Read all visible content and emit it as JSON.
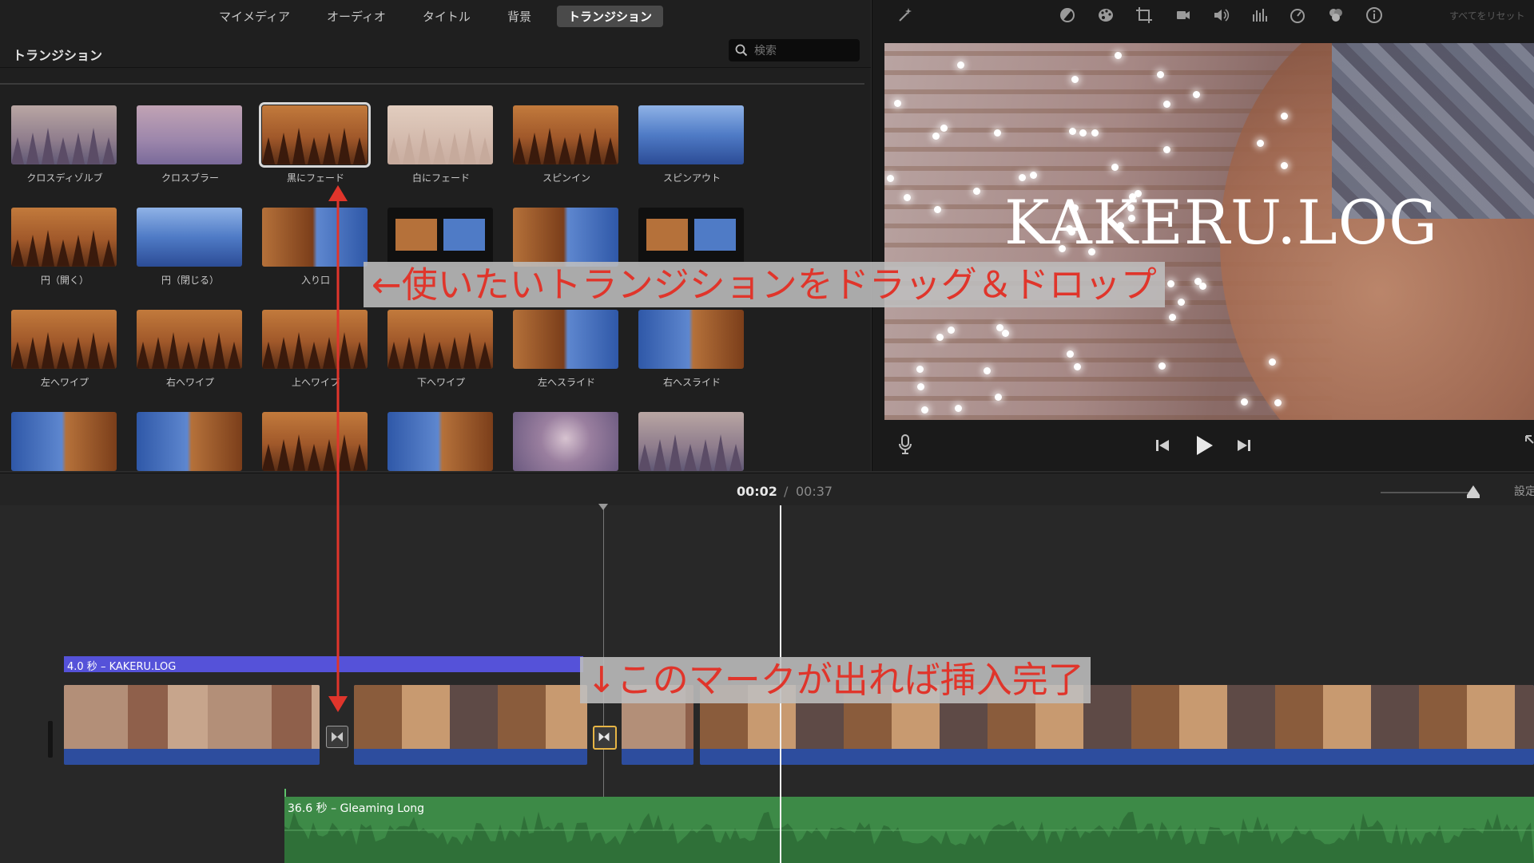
{
  "media_tabs": [
    {
      "label": "マイメディア",
      "active": false
    },
    {
      "label": "オーディオ",
      "active": false
    },
    {
      "label": "タイトル",
      "active": false
    },
    {
      "label": "背景",
      "active": false
    },
    {
      "label": "トランジション",
      "active": true
    }
  ],
  "browser": {
    "title": "トランジション",
    "search_placeholder": "検索"
  },
  "transitions": [
    {
      "label": "クロスディゾルブ",
      "style": "mist",
      "selected": false
    },
    {
      "label": "クロスブラー",
      "style": "blur",
      "selected": false
    },
    {
      "label": "黒にフェード",
      "style": "forest",
      "selected": true
    },
    {
      "label": "白にフェード",
      "style": "pale",
      "selected": false
    },
    {
      "label": "スピンイン",
      "style": "forest",
      "selected": false
    },
    {
      "label": "スピンアウト",
      "style": "blue",
      "selected": false
    },
    {
      "label": "円（開く）",
      "style": "forest",
      "selected": false
    },
    {
      "label": "円（閉じる）",
      "style": "blue",
      "selected": false
    },
    {
      "label": "入り口",
      "style": "half-r",
      "selected": false
    },
    {
      "label": "",
      "style": "black",
      "selected": false
    },
    {
      "label": "",
      "style": "half-r",
      "selected": false
    },
    {
      "label": "",
      "style": "black",
      "selected": false
    },
    {
      "label": "左へワイプ",
      "style": "forest",
      "selected": false
    },
    {
      "label": "右へワイプ",
      "style": "forest",
      "selected": false
    },
    {
      "label": "上へワイプ",
      "style": "forest",
      "selected": false
    },
    {
      "label": "下へワイプ",
      "style": "forest",
      "selected": false
    },
    {
      "label": "左へスライド",
      "style": "half-r",
      "selected": false
    },
    {
      "label": "右へスライド",
      "style": "half-l",
      "selected": false
    },
    {
      "label": "",
      "style": "half-l",
      "selected": false
    },
    {
      "label": "",
      "style": "half-l",
      "selected": false
    },
    {
      "label": "",
      "style": "forest",
      "selected": false
    },
    {
      "label": "",
      "style": "half-l",
      "selected": false
    },
    {
      "label": "",
      "style": "ray",
      "selected": false
    },
    {
      "label": "",
      "style": "mist",
      "selected": false
    }
  ],
  "viewer": {
    "tools": [
      "magic-wand-icon",
      "color-balance-icon",
      "color-correction-icon",
      "crop-icon",
      "stabilization-icon",
      "volume-icon",
      "equalizer-icon",
      "speed-icon",
      "filter-icon",
      "info-icon"
    ],
    "reset_all": "すべてをリセット",
    "preview_title": "KAKERU.LOG"
  },
  "timeline": {
    "current_time": "00:02",
    "separator": "/",
    "total_time": "00:37",
    "settings_label": "設定",
    "title_clip": "4.0 秒 – KAKERU.LOG",
    "audio_clip": "36.6 秒 – Gleaming Long"
  },
  "annotations": {
    "drag_note": "←使いたいトランジションをドラッグ＆ドロップ",
    "done_note": "↓このマークが出れば挿入完了",
    "accent_color": "#e0352b"
  }
}
